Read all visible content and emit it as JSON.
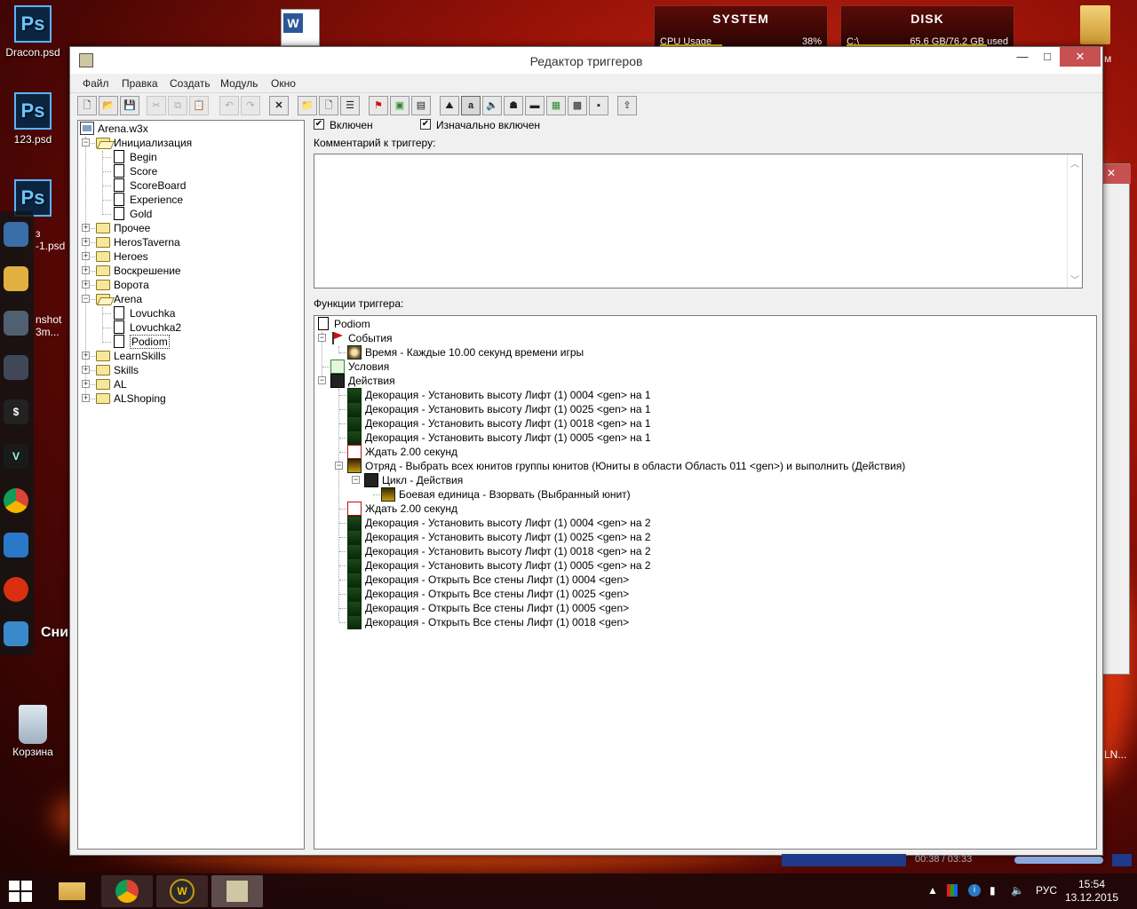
{
  "desktop": {
    "icons": [
      {
        "label": "Dracon.psd",
        "glyph": "Ps"
      },
      {
        "label": "123.psd",
        "glyph": "Ps"
      },
      {
        "label": "",
        "glyph": "Ps"
      },
      {
        "label": "Корзина",
        "glyph": ""
      }
    ],
    "dock_label": "Снимок экрана",
    "fragments": {
      "a": "з",
      "b": "-1.psd",
      "c": "nshot",
      "d": "3m...",
      "e": "м",
      "f": "LN..."
    }
  },
  "widgets": {
    "system": {
      "title": "SYSTEM",
      "row_label": "CPU Usage",
      "row_value": "38%",
      "load": 0.38
    },
    "disk": {
      "title": "DISK",
      "row_label": "C:\\",
      "row_value": "65.6 GB/76.2 GB used",
      "load": 0.86
    }
  },
  "window": {
    "title": "Редактор триггеров",
    "controls": {
      "minimize": "—",
      "maximize": "□",
      "close": "✕"
    },
    "menu": [
      "Файл",
      "Правка",
      "Создать",
      "Модуль",
      "Окно"
    ]
  },
  "toolbar": {
    "icons": [
      "new-icon",
      "open-icon",
      "save-icon",
      "cut-icon",
      "copy-icon",
      "paste-icon",
      "undo-icon",
      "redo-icon",
      "delete-icon",
      "new-category-icon",
      "new-trigger-icon",
      "new-comment-icon",
      "new-event-icon",
      "new-condition-icon",
      "new-action-icon",
      "terrain-icon",
      "doodad-icon",
      "sound-icon",
      "unit-icon",
      "item-icon",
      "ability-icon",
      "upgrade-icon",
      "object-icon",
      "import-icon",
      "test-map-icon"
    ],
    "glyphs": [
      "🗋",
      "📂",
      "💾",
      "✂",
      "⧉",
      "📋",
      "↶",
      "↷",
      "✕",
      "📁",
      "🗋",
      "☰",
      "⚑",
      "▣",
      "▤",
      "⛰",
      "a",
      "🔈",
      "☗",
      "▬",
      "▦",
      "▩",
      "▪",
      "⇪",
      "✔"
    ]
  },
  "tree": {
    "root": "Arena.w3x",
    "nodes": [
      {
        "label": "Инициализация",
        "type": "folder-open",
        "level": 1,
        "expanded": true
      },
      {
        "label": "Begin",
        "type": "trigger",
        "level": 2
      },
      {
        "label": "Score",
        "type": "trigger",
        "level": 2
      },
      {
        "label": "ScoreBoard",
        "type": "trigger",
        "level": 2
      },
      {
        "label": "Experience",
        "type": "trigger",
        "level": 2
      },
      {
        "label": "Gold",
        "type": "trigger",
        "level": 2
      },
      {
        "label": "Прочее",
        "type": "folder",
        "level": 1
      },
      {
        "label": "HerosTaverna",
        "type": "folder",
        "level": 1
      },
      {
        "label": "Heroes",
        "type": "folder",
        "level": 1
      },
      {
        "label": "Воскрешение",
        "type": "folder",
        "level": 1
      },
      {
        "label": "Ворота",
        "type": "folder",
        "level": 1
      },
      {
        "label": "Arena",
        "type": "folder-open",
        "level": 1,
        "expanded": true
      },
      {
        "label": "Lovuchka",
        "type": "trigger",
        "level": 2
      },
      {
        "label": "Lovuchka2",
        "type": "trigger",
        "level": 2
      },
      {
        "label": "Podiom",
        "type": "trigger",
        "level": 2,
        "selected": true
      },
      {
        "label": "LearnSkills",
        "type": "folder",
        "level": 1
      },
      {
        "label": "Skills",
        "type": "folder",
        "level": 1
      },
      {
        "label": "AL",
        "type": "folder",
        "level": 1
      },
      {
        "label": "ALShoping",
        "type": "folder",
        "level": 1
      }
    ]
  },
  "trigger": {
    "enabled_label": "Включен",
    "initially_on_label": "Изначально включен",
    "comment_label": "Комментарий к триггеру:",
    "comment_value": "",
    "functions_label": "Функции триггера:",
    "name": "Podiom",
    "events_label": "События",
    "conditions_label": "Условия",
    "actions_label": "Действия",
    "events": [
      "Время - Каждые 10.00 секунд времени игры"
    ],
    "actions": [
      {
        "text": "Декорация - Установить высоту Лифт (1) 0004 <gen> на 1",
        "kind": "doodad",
        "level": 0
      },
      {
        "text": "Декорация - Установить высоту Лифт (1) 0025 <gen> на 1",
        "kind": "doodad",
        "level": 0
      },
      {
        "text": "Декорация - Установить высоту Лифт (1) 0018 <gen> на 1",
        "kind": "doodad",
        "level": 0
      },
      {
        "text": "Декорация - Установить высоту Лифт (1) 0005 <gen> на 1",
        "kind": "doodad",
        "level": 0
      },
      {
        "text": "Ждать 2.00 секунд",
        "kind": "wait",
        "level": 0
      },
      {
        "text": "Отряд - Выбрать всех юнитов группы юнитов (Юниты в области Область 011 <gen>) и выполнить (Действия)",
        "kind": "group",
        "level": 0
      },
      {
        "text": "Цикл - Действия",
        "kind": "loop",
        "level": 1
      },
      {
        "text": "Боевая единица - Взорвать (Выбранный юнит)",
        "kind": "unit",
        "level": 2
      },
      {
        "text": "Ждать 2.00 секунд",
        "kind": "wait",
        "level": 0
      },
      {
        "text": "Декорация - Установить высоту Лифт (1) 0004 <gen> на 2",
        "kind": "doodad",
        "level": 0
      },
      {
        "text": "Декорация - Установить высоту Лифт (1) 0025 <gen> на 2",
        "kind": "doodad",
        "level": 0
      },
      {
        "text": "Декорация - Установить высоту Лифт (1) 0018 <gen> на 2",
        "kind": "doodad",
        "level": 0
      },
      {
        "text": "Декорация - Установить высоту Лифт (1) 0005 <gen> на 2",
        "kind": "doodad",
        "level": 0
      },
      {
        "text": "Декорация - Открыть Все стены Лифт (1) 0004 <gen>",
        "kind": "doodad",
        "level": 0
      },
      {
        "text": "Декорация - Открыть Все стены Лифт (1) 0025 <gen>",
        "kind": "doodad",
        "level": 0
      },
      {
        "text": "Декорация - Открыть Все стены Лифт (1) 0005 <gen>",
        "kind": "doodad",
        "level": 0
      },
      {
        "text": "Декорация - Открыть Все стены Лифт (1) 0018 <gen>",
        "kind": "doodad",
        "level": 0
      }
    ]
  },
  "media_player": {
    "time": "00:38 / 03:33"
  },
  "taskbar": {
    "apps": [
      "explorer-icon",
      "chrome-icon",
      "warcraft-icon",
      "world-editor-icon"
    ],
    "language": "РУС",
    "time": "15:54",
    "date": "13.12.2015"
  },
  "colors": {
    "event_flag": "#d01010",
    "doodad_icon": "#2f8a2f",
    "wait_icon": "#b81010",
    "group_icon": "#c89a10",
    "titlebar_close": "#c75050"
  }
}
